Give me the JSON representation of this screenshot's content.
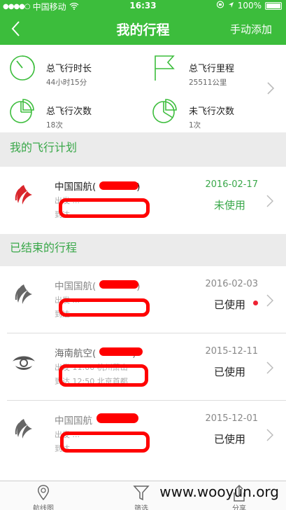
{
  "status_bar": {
    "carrier": "中国移动",
    "time": "16:33",
    "battery": "100%"
  },
  "nav": {
    "title": "我的行程",
    "action": "手动添加"
  },
  "stats": [
    {
      "label": "总飞行时长",
      "value": "44小时15分",
      "icon": "clock-icon"
    },
    {
      "label": "总飞行里程",
      "value": "25511公里",
      "icon": "flag-icon"
    },
    {
      "label": "总飞行次数",
      "value": "18次",
      "icon": "pie-chart-icon"
    },
    {
      "label": "未飞行次数",
      "value": "1次",
      "icon": "pie-chart-icon"
    }
  ],
  "sections": {
    "plan": "我的飞行计划",
    "done": "已结束的行程"
  },
  "trips": [
    {
      "airline": "中国国航(",
      "airline_suffix": ")",
      "route1": "出发 ...",
      "route2": "到达 ...",
      "date": "2016-02-17",
      "status": "未使用"
    },
    {
      "airline": "中国国航(",
      "airline_suffix": ")",
      "route1": "出发 ...",
      "route2": "到达 ...",
      "date": "2016-02-03",
      "status": "已使用"
    },
    {
      "airline": "海南航空(",
      "airline_suffix": ")",
      "route1": "出发 11:00 杭州萧山",
      "route2": "到达 12:50 北京首都",
      "date": "2015-12-11",
      "status": "已使用"
    },
    {
      "airline": "中国国航",
      "airline_suffix": "",
      "route1": "出发 ...",
      "route2": "到达 ...",
      "date": "2015-12-01",
      "status": "已使用"
    }
  ],
  "tabs": [
    {
      "label": "航线图"
    },
    {
      "label": "筛选"
    },
    {
      "label": "分享"
    }
  ],
  "watermark": "www.wooyun.org",
  "colors": {
    "brand": "#3cbd3c",
    "section": "#3aa84a",
    "unused": "#3aa84a",
    "redact": "#ff0000"
  }
}
